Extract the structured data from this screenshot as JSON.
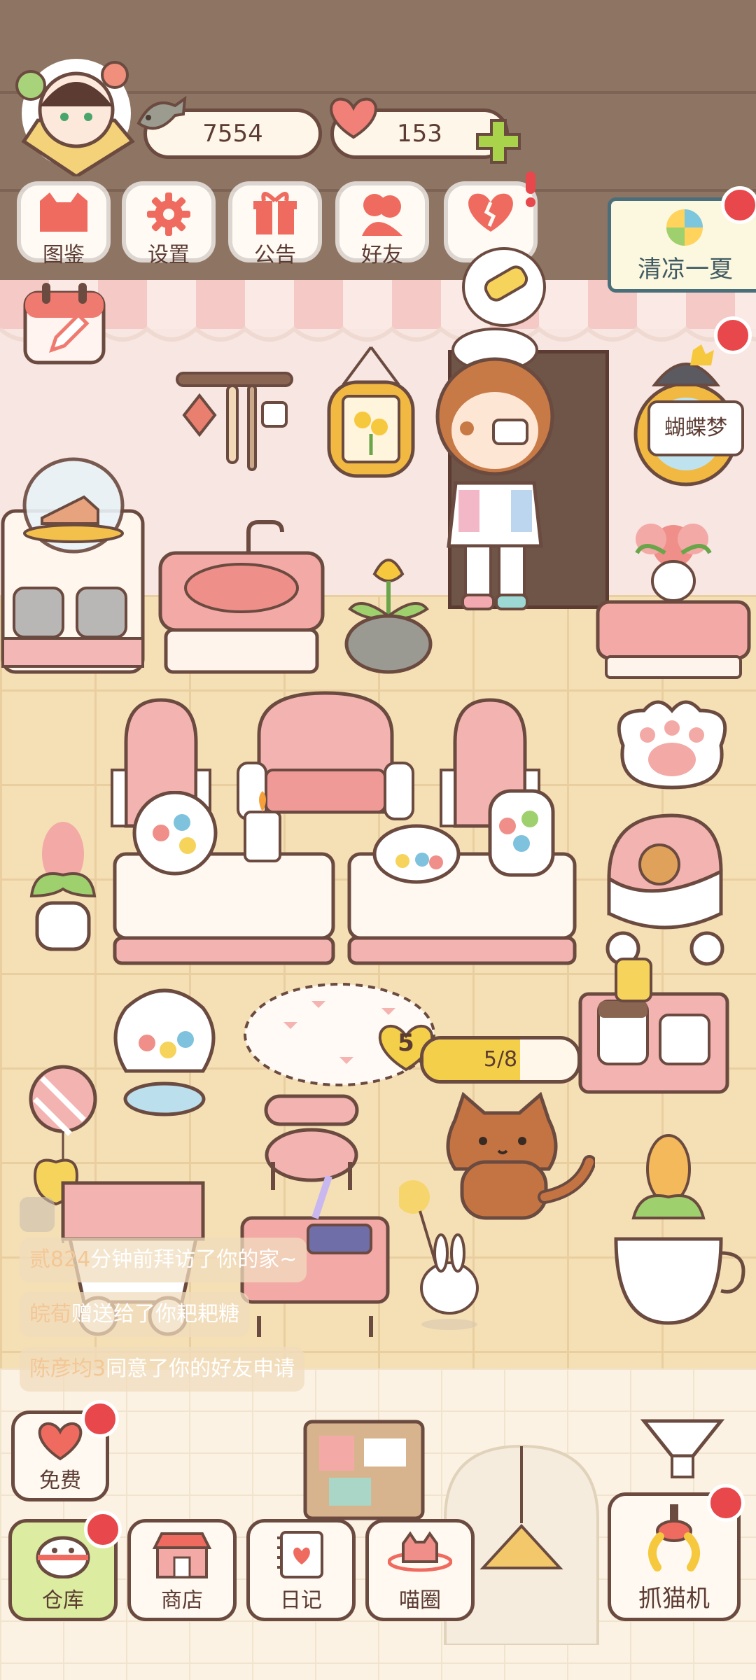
{
  "header": {
    "fish_count": "7554",
    "heart_count": "153"
  },
  "menu": {
    "items": [
      {
        "label": "图鉴",
        "icon": "cat-book-icon"
      },
      {
        "label": "设置",
        "icon": "gear-icon"
      },
      {
        "label": "公告",
        "icon": "gift-icon"
      },
      {
        "label": "好友",
        "icon": "friends-icon"
      },
      {
        "label": "",
        "icon": "broken-heart-icon"
      }
    ]
  },
  "events": {
    "summer_banner": "清凉一夏",
    "butterfly_sign": "蝴蝶梦"
  },
  "cat": {
    "level": "5",
    "progress_text": "5/8",
    "progress_fraction": 0.625
  },
  "feed": [
    {
      "name": "贰824",
      "text": "分钟前拜访了你的家~"
    },
    {
      "name": "皖荀",
      "text": "赠送给了你耙耙糖"
    },
    {
      "name": "陈彦均3",
      "text": "同意了你的好友申请"
    }
  ],
  "bottom": {
    "free_label": "免费",
    "warehouse_label": "仓库",
    "shop_label": "商店",
    "diary_label": "日记",
    "circle_label": "喵圈",
    "claw_label": "抓猫机"
  },
  "colors": {
    "accent_pink": "#ef6b5f",
    "badge_red": "#e8474b",
    "outline_brown": "#6b4a40",
    "progress_yellow": "#f4cf4a"
  }
}
